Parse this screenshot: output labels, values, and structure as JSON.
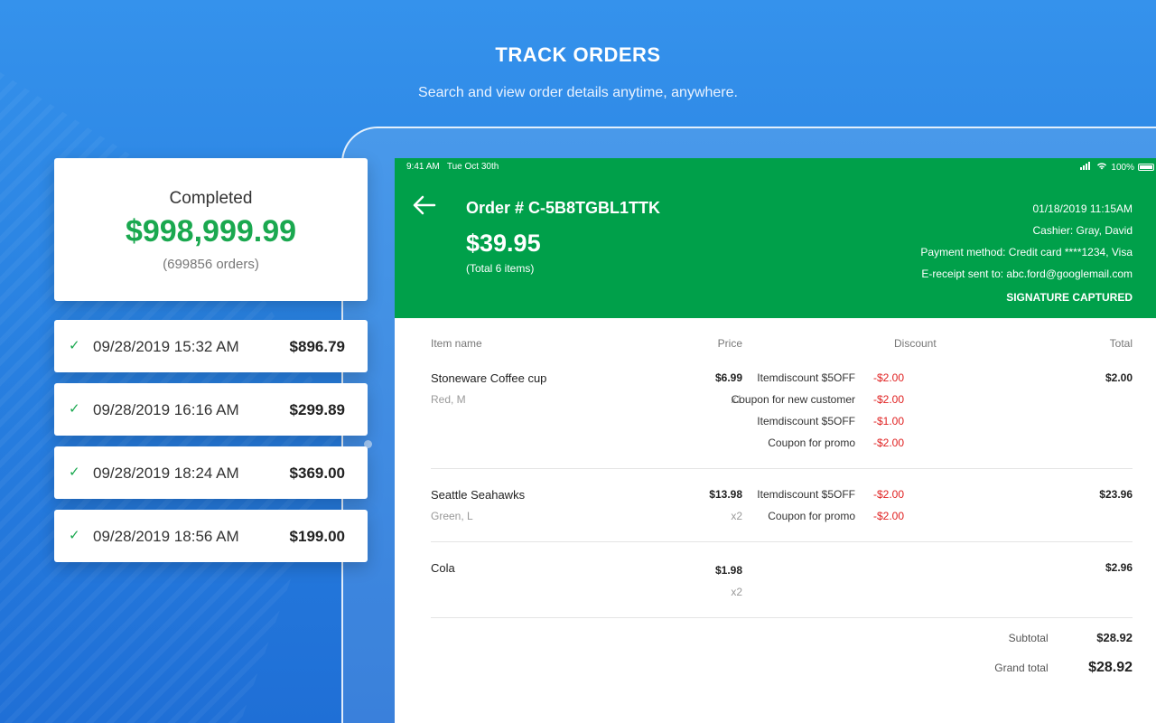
{
  "hero": {
    "title": "TRACK ORDERS",
    "subtitle": "Search and view order details anytime, anywhere."
  },
  "summary": {
    "label": "Completed",
    "amount": "$998,999.99",
    "count": "(699856 orders)"
  },
  "transactions": [
    {
      "date": "09/28/2019 15:32 AM",
      "amount": "$896.79"
    },
    {
      "date": "09/28/2019 16:16 AM",
      "amount": "$299.89"
    },
    {
      "date": "09/28/2019 18:24 AM",
      "amount": "$369.00"
    },
    {
      "date": "09/28/2019 18:56 AM",
      "amount": "$199.00"
    }
  ],
  "status_bar": {
    "time": "9:41 AM",
    "date": "Tue Oct 30th",
    "battery": "100%"
  },
  "order": {
    "number": "Order # C-5B8TGBL1TTK",
    "total": "$39.95",
    "items": "(Total 6 items)",
    "datetime": "01/18/2019 11:15AM",
    "cashier": "Cashier: Gray, David",
    "payment": "Payment method: Credit card ****1234, Visa",
    "receipt": "E-receipt sent to: abc.ford@googlemail.com",
    "signature": "SIGNATURE CAPTURED"
  },
  "table": {
    "headers": {
      "name": "Item name",
      "price": "Price",
      "discount": "Discount",
      "total": "Total"
    },
    "rows": [
      {
        "name": "Stoneware Coffee cup",
        "variant": "Red, M",
        "price": "$6.99",
        "qty": "x1",
        "total": "$2.00",
        "discounts": [
          {
            "label": "Itemdiscount $5OFF",
            "amount": "-$2.00"
          },
          {
            "label": "Coupon for new customer",
            "amount": "-$2.00"
          },
          {
            "label": "Itemdiscount $5OFF",
            "amount": "-$1.00"
          },
          {
            "label": "Coupon for promo",
            "amount": "-$2.00"
          }
        ]
      },
      {
        "name": "Seattle Seahawks",
        "variant": "Green, L",
        "price": "$13.98",
        "qty": "x2",
        "total": "$23.96",
        "discounts": [
          {
            "label": "Itemdiscount $5OFF",
            "amount": "-$2.00"
          },
          {
            "label": "Coupon for promo",
            "amount": "-$2.00"
          }
        ]
      },
      {
        "name": "Cola",
        "variant": "",
        "price": "$1.98",
        "qty": "x2",
        "total": "$2.96",
        "discounts": []
      }
    ]
  },
  "totals": {
    "subtotal_label": "Subtotal",
    "subtotal": "$28.92",
    "grand_label": "Grand total",
    "grand": "$28.92"
  },
  "colors": {
    "brand_green": "#00a04a",
    "accent_green": "#1aa84f",
    "discount_red": "#e02020",
    "bg_blue": "#2a83e2"
  },
  "icons": {
    "back": "arrow-left-icon",
    "check": "check-icon",
    "wifi": "wifi-icon",
    "signal": "signal-icon",
    "battery": "battery-icon"
  }
}
